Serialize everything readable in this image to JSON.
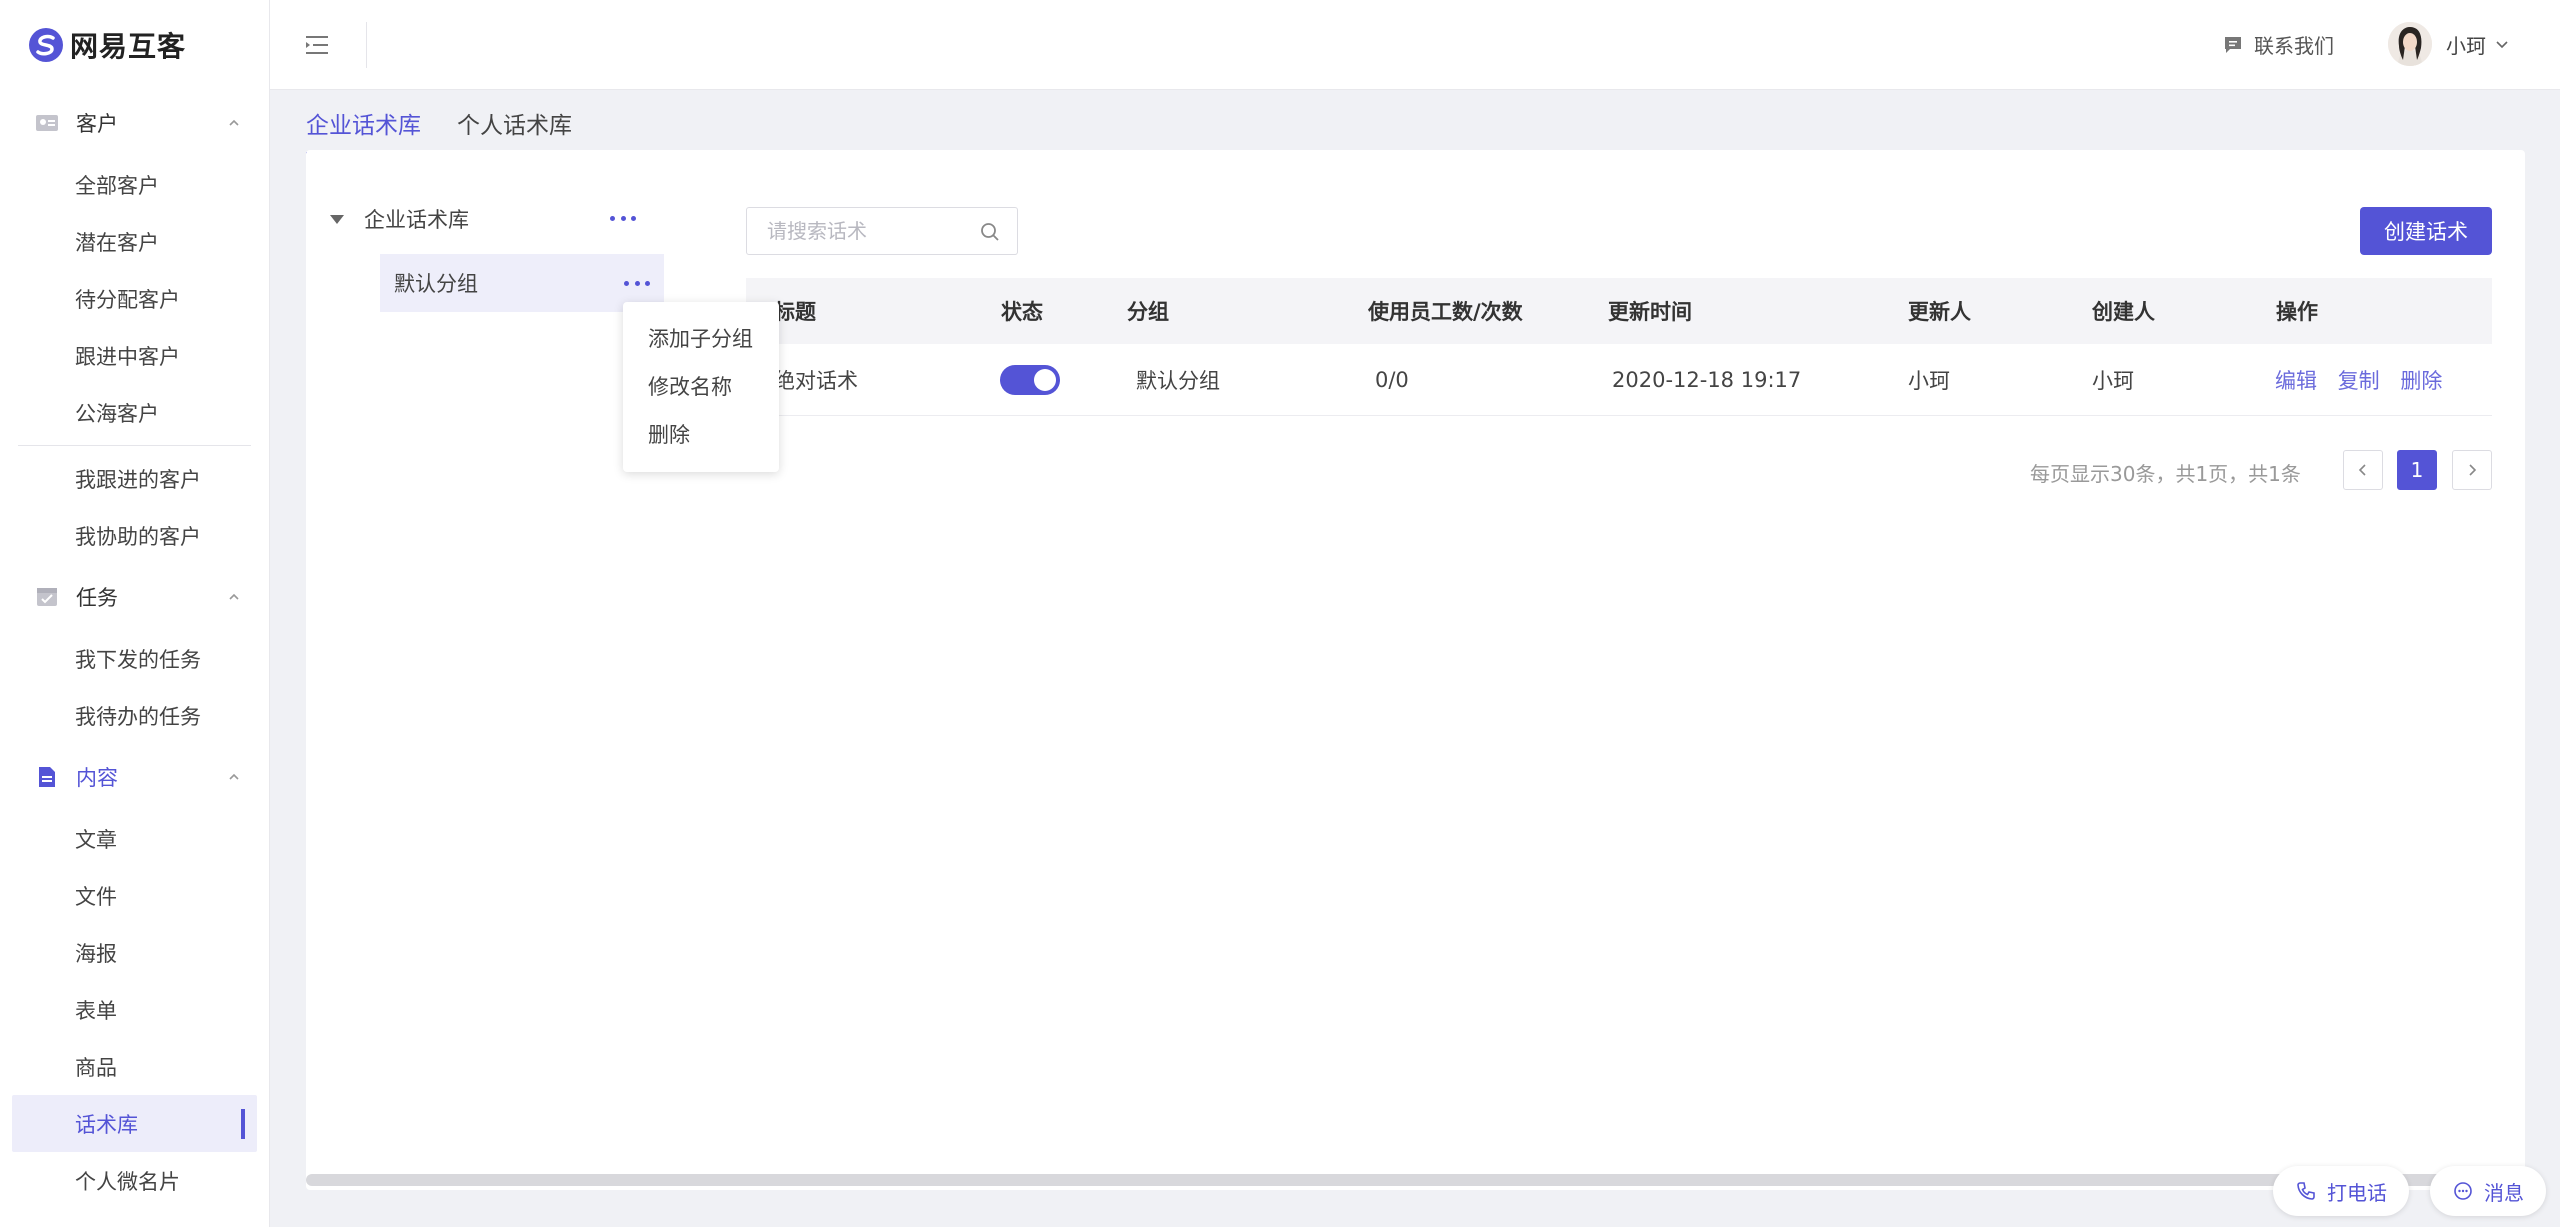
{
  "brand": {
    "name": "网易互客"
  },
  "sidebar": {
    "groups": [
      {
        "label": "客户",
        "items": [
          "全部客户",
          "潜在客户",
          "待分配客户",
          "跟进中客户",
          "公海客户",
          "我跟进的客户",
          "我协助的客户"
        ]
      },
      {
        "label": "任务",
        "items": [
          "我下发的任务",
          "我待办的任务"
        ]
      },
      {
        "label": "内容",
        "items": [
          "文章",
          "文件",
          "海报",
          "表单",
          "商品",
          "话术库",
          "个人微名片"
        ],
        "active_item": "话术库"
      }
    ]
  },
  "header": {
    "contact": "联系我们",
    "username": "小珂"
  },
  "tabs": [
    "企业话术库",
    "个人话术库"
  ],
  "tree": {
    "root": "企业话术库",
    "node": "默认分组",
    "menu": [
      "添加子分组",
      "修改名称",
      "删除"
    ]
  },
  "search": {
    "placeholder": "请搜索话术"
  },
  "create_button": "创建话术",
  "table": {
    "headers": [
      "标题",
      "状态",
      "分组",
      "使用员工数/次数",
      "更新时间",
      "更新人",
      "创建人",
      "操作"
    ],
    "rows": [
      {
        "title": "绝对话术",
        "status_on": true,
        "group": "默认分组",
        "usage": "0/0",
        "updated": "2020-12-18 19:17",
        "updater": "小珂",
        "creator": "小珂",
        "ops": [
          "编辑",
          "复制",
          "删除"
        ]
      }
    ]
  },
  "pagination": {
    "info": "每页显示30条，共1页，共1条",
    "current": "1"
  },
  "float": {
    "call": "打电话",
    "message": "消息"
  },
  "colors": {
    "accent": "#5454d6"
  }
}
